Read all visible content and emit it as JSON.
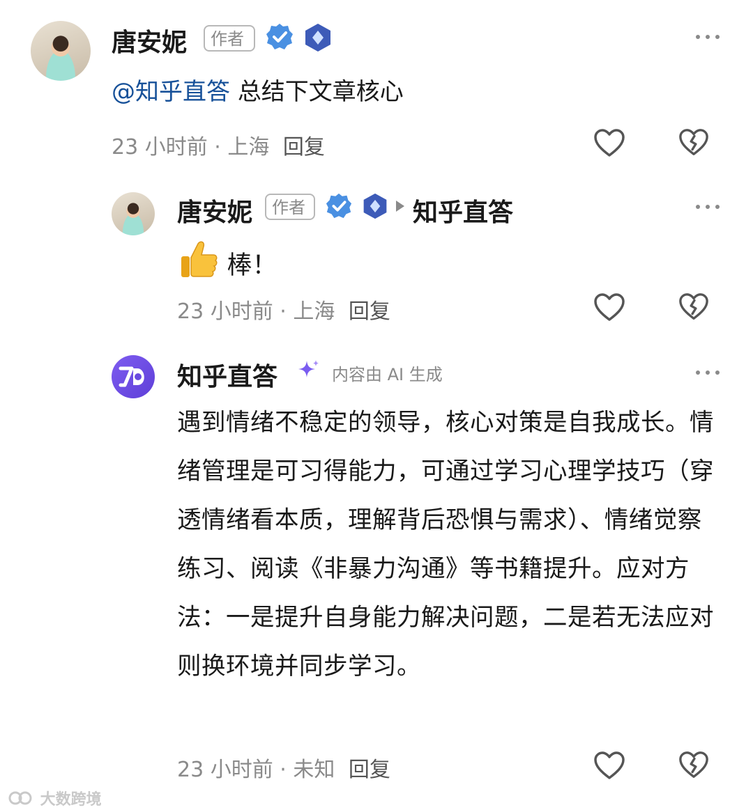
{
  "comments": [
    {
      "author": "唐安妮",
      "author_tag": "作者",
      "mention": "@知乎直答",
      "text": "总结下文章核心",
      "time": "23 小时前",
      "location": "上海",
      "reply_label": "回复"
    },
    {
      "author": "唐安妮",
      "author_tag": "作者",
      "reply_to": "知乎直答",
      "text": "棒！",
      "time": "23 小时前",
      "location": "上海",
      "reply_label": "回复"
    },
    {
      "author": "知乎直答",
      "ai_label": "内容由 AI 生成",
      "text": "遇到情绪不稳定的领导，核心对策是自我成长。情绪管理是可习得能力，可通过学习心理学技巧（穿透情绪看本质，理解背后恐惧与需求）、情绪觉察练习、阅读《非暴力沟通》等书籍提升。应对方法：一是提升自身能力解决问题，二是若无法应对则换环境并同步学习。",
      "time": "23 小时前",
      "location": "未知",
      "reply_label": "回复"
    }
  ],
  "separator": "·",
  "watermark": "大数跨境",
  "icons": {
    "verified": "verified-check-icon",
    "level": "diamond-badge-icon",
    "like": "heart-icon",
    "dislike": "broken-heart-icon",
    "more": "more-dots-icon",
    "sparkle": "ai-sparkle-icon",
    "thumbs": "thumbs-up-emoji"
  },
  "colors": {
    "mention": "#175199",
    "verified": "#4a90e2",
    "level": "#3d5bb8",
    "ai_sparkle": "#7a5cf0",
    "muted": "#8a8a8a"
  }
}
